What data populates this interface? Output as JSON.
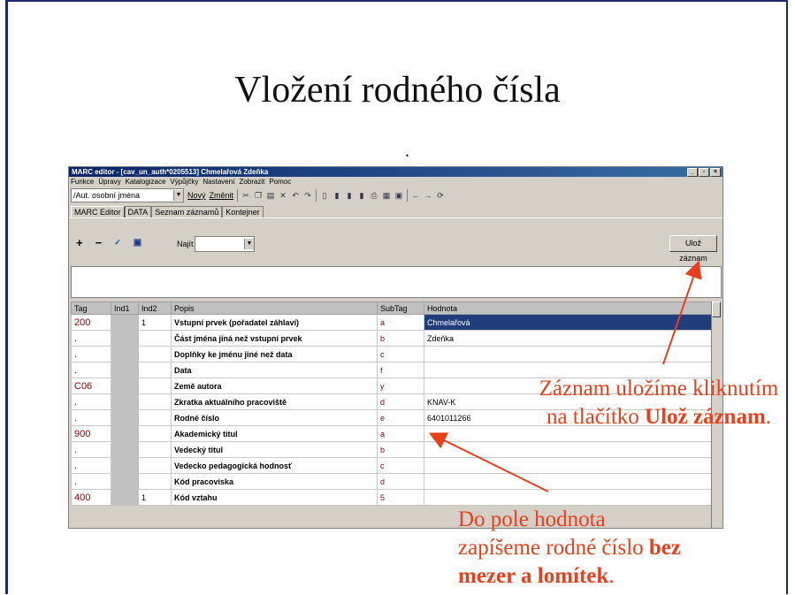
{
  "slide": {
    "title": "Vložení rodného čísla",
    "dot": "."
  },
  "app": {
    "window_title": "MARC editor - [cav_un_auth*0205513] Chmelařová Zdeňka",
    "menu": [
      "Funkce",
      "Úpravy",
      "Katalogizace",
      "Výpůjčky",
      "Nastavení",
      "Zobrazit",
      "Pomoc"
    ],
    "toolbar": {
      "base_select": "/Aut. osobní jména",
      "new_label": "Nový",
      "change_label": "Změnit"
    },
    "tabs": [
      "MARC Editor",
      "DATA",
      "Seznam záznamů",
      "Kontejner"
    ],
    "panel": {
      "add": "+",
      "remove": "−",
      "find_label": "Najít",
      "find_value": "",
      "save_label": "Ulož záznam"
    },
    "grid": {
      "headers": [
        "Tag",
        "Ind1",
        "Ind2",
        "Popis",
        "SubTag",
        "Hodnota"
      ],
      "rows": [
        {
          "tag": "200",
          "ind1": "",
          "ind2": "1",
          "desc": "Vstupní prvek (pořadatel záhlaví)",
          "sub": "a",
          "val": "Chmelařová",
          "selected": true
        },
        {
          "tag": ".",
          "ind1": "",
          "ind2": "",
          "desc": "Část jména jiná než vstupní prvek",
          "sub": "b",
          "val": "Zdeňka"
        },
        {
          "tag": ".",
          "ind1": "",
          "ind2": "",
          "desc": "Doplňky ke jménu jiné než data",
          "sub": "c",
          "val": ""
        },
        {
          "tag": ".",
          "ind1": "",
          "ind2": "",
          "desc": "Data",
          "sub": "f",
          "val": ""
        },
        {
          "tag": "C06",
          "ind1": "",
          "ind2": "",
          "desc": "Země autora",
          "sub": "y",
          "val": ""
        },
        {
          "tag": ".",
          "ind1": "",
          "ind2": "",
          "desc": "Zkratka aktuálního pracoviště",
          "sub": "d",
          "val": "KNAV-K"
        },
        {
          "tag": ".",
          "ind1": "",
          "ind2": "",
          "desc": "Rodné číslo",
          "sub": "e",
          "val": "6401011266"
        },
        {
          "tag": "900",
          "ind1": "",
          "ind2": "",
          "desc": "Akademický titul",
          "sub": "a",
          "val": ""
        },
        {
          "tag": ".",
          "ind1": "",
          "ind2": "",
          "desc": "Vedecký titul",
          "sub": "b",
          "val": ""
        },
        {
          "tag": ".",
          "ind1": "",
          "ind2": "",
          "desc": "Vedecko pedagogická hodnosť",
          "sub": "c",
          "val": ""
        },
        {
          "tag": ".",
          "ind1": "",
          "ind2": "",
          "desc": "Kód pracoviska",
          "sub": "d",
          "val": ""
        },
        {
          "tag": "400",
          "ind1": "",
          "ind2": "1",
          "desc": "Kód vztahu",
          "sub": "5",
          "val": ""
        }
      ]
    }
  },
  "notes": {
    "note1_line1": "Záznam uložíme kliknutím",
    "note1_line2_pre": "na tlačítko ",
    "note1_line2_bold": "Ulož záznam",
    "note1_line2_post": ".",
    "note2_line1": "Do pole hodnota",
    "note2_line2_pre": "zapíšeme rodné číslo ",
    "note2_line2_bold": "bez",
    "note2_line3_bold": "mezer a lomítek",
    "note2_line3_post": "."
  },
  "colors": {
    "annotation": "#e8401c",
    "titlebar": "#0a246a",
    "selection": "#1f3d7a"
  }
}
